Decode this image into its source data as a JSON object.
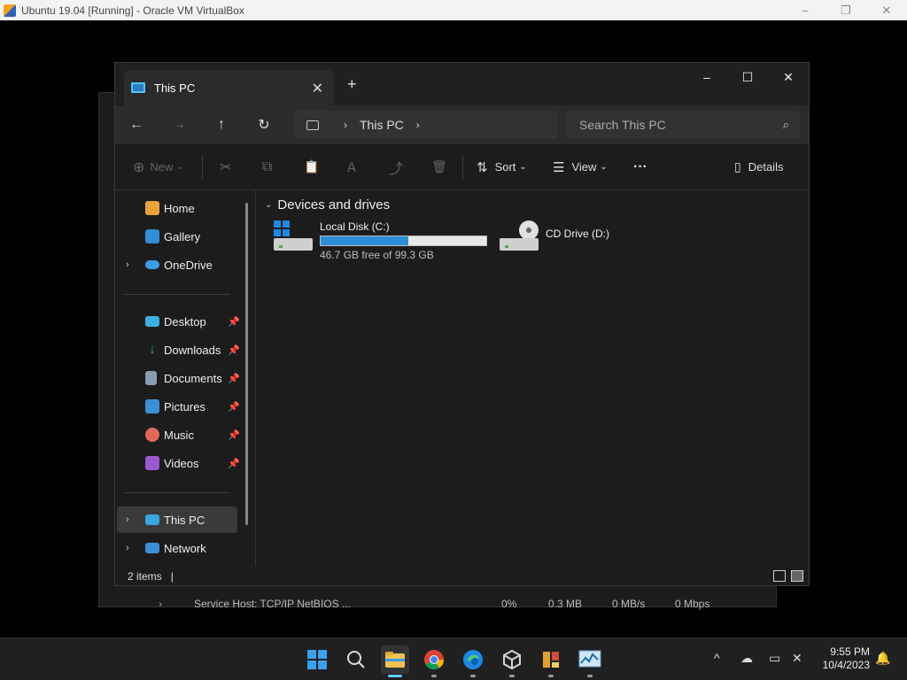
{
  "host": {
    "title": "Ubuntu 19.04 [Running] - Oracle VM VirtualBox",
    "minimize": "–",
    "restore": "❐",
    "close": "✕"
  },
  "background_window": {
    "row_name": "Service Host: TCP/IP NetBIOS ...",
    "cpu": "0%",
    "memory": "0.3 MB",
    "disk": "0 MB/s",
    "network": "0 Mbps",
    "expand": "›"
  },
  "explorer": {
    "tab_title": "This PC",
    "tab_close": "✕",
    "new_tab": "+",
    "window_minimize": "–",
    "window_maximize": "☐",
    "window_close": "✕",
    "nav": {
      "back": "←",
      "forward": "→",
      "up": "↑",
      "refresh": "↻"
    },
    "address": {
      "segment": "This PC",
      "chevron": "›"
    },
    "search": {
      "placeholder": "Search This PC",
      "icon": "⌕"
    },
    "commands": {
      "new_label": "New",
      "sort_label": "Sort",
      "view_label": "View",
      "more": "···",
      "details_label": "Details",
      "new_icon": "⊕",
      "cut_icon": "✂",
      "copy_icon": "⧉",
      "paste_icon": "📋",
      "rename_icon": "Ａ",
      "share_icon": "⤴",
      "delete_icon": "🗑",
      "sort_icon": "⇅",
      "view_icon": "☰",
      "details_icon": "▯",
      "dropdown": "⌄"
    },
    "sidebar": {
      "items": [
        {
          "label": "Home",
          "color": "#e8a33a"
        },
        {
          "label": "Gallery",
          "color": "#2f8fd8"
        },
        {
          "label": "OneDrive",
          "color": "#3a9be8"
        },
        {
          "label": "Desktop",
          "color": "#3bb0e0"
        },
        {
          "label": "Downloads",
          "color": "#3ca35b"
        },
        {
          "label": "Documents",
          "color": "#8a9bb0"
        },
        {
          "label": "Pictures",
          "color": "#3a8fd6"
        },
        {
          "label": "Music",
          "color": "#e06a5a"
        },
        {
          "label": "Videos",
          "color": "#9b59d0"
        },
        {
          "label": "This PC",
          "color": "#3aa6e0"
        },
        {
          "label": "Network",
          "color": "#3a8fd6"
        }
      ],
      "expand": "›",
      "pin": "📌"
    },
    "content": {
      "group_title": "Devices and drives",
      "group_chevron": "⌄",
      "drives": [
        {
          "name": "Local Disk (C:)",
          "free": "46.7 GB free of 99.3 GB",
          "used_fraction": 0.53
        },
        {
          "name": "CD Drive (D:)"
        }
      ]
    },
    "status": {
      "items": "2 items",
      "caret": "|"
    }
  },
  "taskbar": {
    "clock_time": "9:55 PM",
    "clock_date": "10/4/2023",
    "tray_chevron": "^",
    "colors": {
      "accent": "#60cdff",
      "start": "#1e88e5"
    }
  }
}
